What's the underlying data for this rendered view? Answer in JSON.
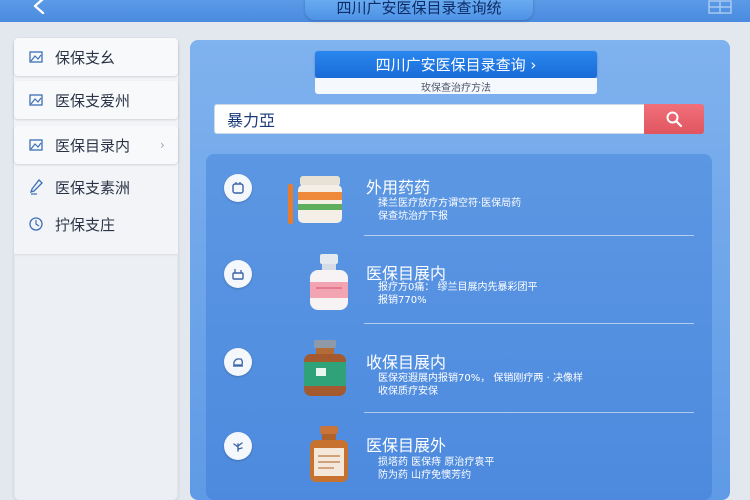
{
  "header": {
    "title": "四川广安医保目录查询统"
  },
  "sidebar": {
    "items": [
      {
        "label": "保保支幺"
      },
      {
        "label": "医保支爱州"
      },
      {
        "label": "医保目录内"
      },
      {
        "label": "医保支素洲"
      },
      {
        "label": "拧保支庄"
      }
    ]
  },
  "main": {
    "title_button": "四川广安医保目录查询 ›",
    "subtitle": "玫保查治疗方法",
    "search": {
      "value": "暴力亞"
    },
    "items": [
      {
        "title": "外用药药",
        "desc_line1": "揉兰医疗放疗方谓空符·医保局药",
        "desc_line2": "保查坑治疗下报"
      },
      {
        "title": "医保目展内",
        "desc_line1": "报疗方0痛：  缪兰目展内先暴彩团平",
        "desc_line2": "报销770%"
      },
      {
        "title": "收保目展内",
        "desc_line1": "医保宛遐展内报销70%，  保销刚疗两 · 决像样",
        "desc_line2": "收保质疗安保"
      },
      {
        "title": "医保目展外",
        "desc_line1": "损塔药     医保痔 原治疗袁平",
        "desc_line2": "防为药 山疗免懊芳约"
      }
    ]
  }
}
